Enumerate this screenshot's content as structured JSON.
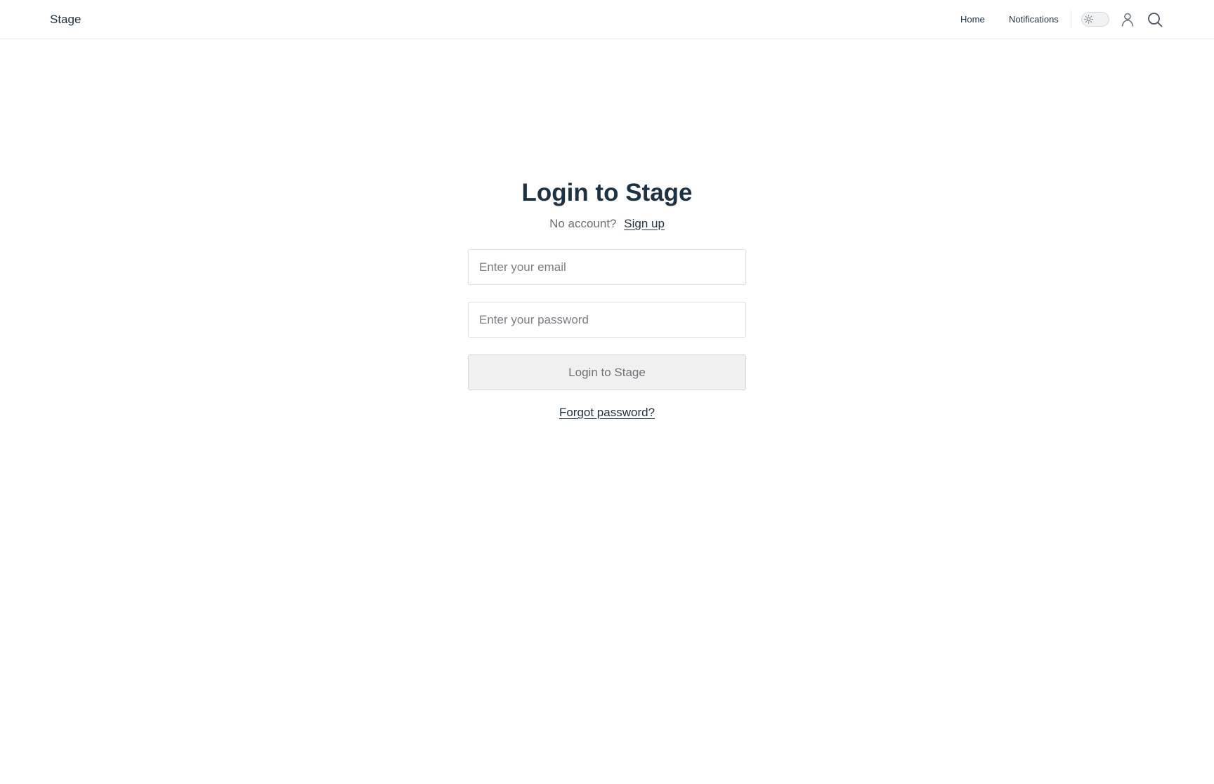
{
  "header": {
    "brand": "Stage",
    "nav": {
      "home": "Home",
      "notifications": "Notifications"
    },
    "icons": {
      "theme_toggle": "sun-icon",
      "account": "user-icon",
      "search": "search-icon"
    }
  },
  "login": {
    "title": "Login to Stage",
    "no_account_text": "No account?",
    "signup_link": "Sign up",
    "email_placeholder": "Enter your email",
    "email_value": "",
    "password_placeholder": "Enter your password",
    "password_value": "",
    "submit_label": "Login to Stage",
    "forgot_link": "Forgot password?"
  },
  "colors": {
    "text_primary": "#1f3244",
    "text_muted": "#6b7178",
    "border": "#dcdfe3",
    "button_disabled_bg": "#f0f0f0"
  }
}
